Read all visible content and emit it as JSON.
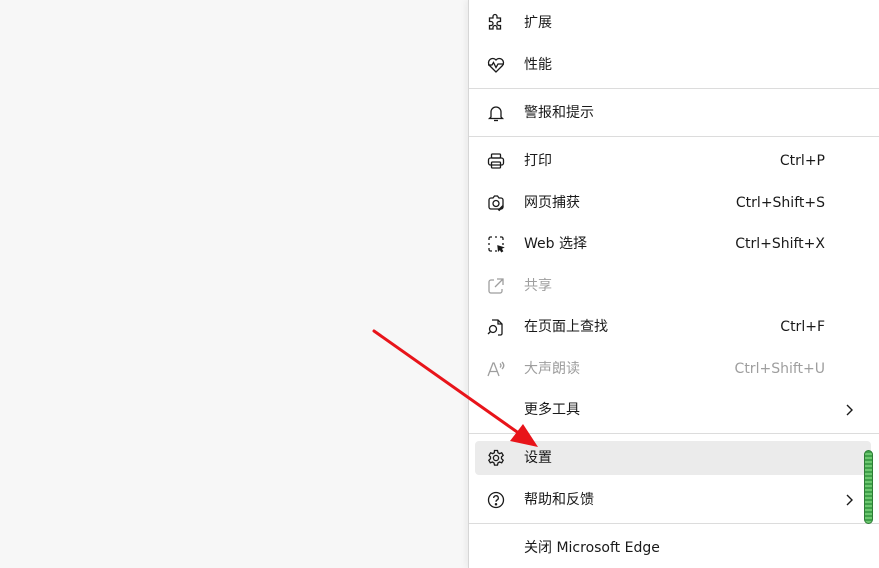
{
  "menu": {
    "items": [
      {
        "label": "扩展",
        "icon": "puzzle-icon"
      },
      {
        "label": "性能",
        "icon": "heartbeat-icon"
      },
      {
        "label": "警报和提示",
        "icon": "bell-icon"
      },
      {
        "label": "打印",
        "shortcut": "Ctrl+P",
        "icon": "printer-icon"
      },
      {
        "label": "网页捕获",
        "shortcut": "Ctrl+Shift+S",
        "icon": "screenshot-icon"
      },
      {
        "label": "Web 选择",
        "shortcut": "Ctrl+Shift+X",
        "icon": "web-select-icon"
      },
      {
        "label": "共享",
        "icon": "share-icon",
        "disabled": true
      },
      {
        "label": "在页面上查找",
        "shortcut": "Ctrl+F",
        "icon": "find-icon"
      },
      {
        "label": "大声朗读",
        "shortcut": "Ctrl+Shift+U",
        "icon": "read-aloud-icon",
        "disabled": true
      },
      {
        "label": "更多工具",
        "icon": "chevron-right-icon"
      },
      {
        "label": "设置",
        "icon": "gear-icon",
        "highlighted": true
      },
      {
        "label": "帮助和反馈",
        "icon": "help-icon"
      },
      {
        "label": "关闭 Microsoft Edge"
      }
    ]
  },
  "colors": {
    "annotation_arrow": "#e8141a",
    "disabled_text": "#9e9e9e",
    "hover_bg": "#ebebeb",
    "scrollbar": "#3fa04a"
  }
}
